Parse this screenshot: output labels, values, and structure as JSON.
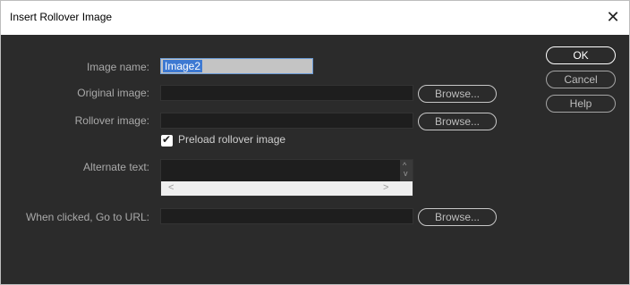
{
  "dialog": {
    "title": "Insert Rollover Image",
    "close_icon": "close-icon"
  },
  "form": {
    "image_name_label": "Image name:",
    "image_name_value": "Image2",
    "original_image_label": "Original image:",
    "original_image_value": "",
    "rollover_image_label": "Rollover image:",
    "rollover_image_value": "",
    "preload_label": "Preload rollover image",
    "preload_checked": true,
    "alternate_text_label": "Alternate text:",
    "alternate_text_value": "",
    "url_label": "When clicked, Go to URL:",
    "url_value": "",
    "browse_label": "Browse..."
  },
  "buttons": {
    "ok": "OK",
    "cancel": "Cancel",
    "help": "Help"
  },
  "scroll_glyphs": {
    "left": "<",
    "right": ">",
    "up": "^",
    "down": "v"
  }
}
